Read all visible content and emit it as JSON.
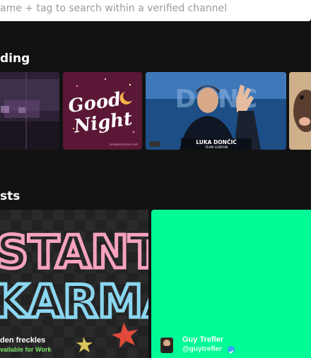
{
  "search": {
    "placeholder": "ame + tag to search within a verified channel"
  },
  "sections": {
    "trending_title": "ding",
    "artists_title": "sts"
  },
  "trending": {
    "cards": [
      {
        "id": "card-1"
      },
      {
        "id": "card-2",
        "text_line1": "Good",
        "text_line2": "Night",
        "watermark": "sendwishonline.com"
      },
      {
        "id": "card-3",
        "player_name": "LUKA DONČIĆ",
        "team": "TEAM LEBRON",
        "backdrop_text": "DONC"
      },
      {
        "id": "card-4"
      }
    ]
  },
  "artists": [
    {
      "name": "den freckles",
      "subtitle": "vailable for Work",
      "subtitle_color": "#7ee36b",
      "art_text_1": "STANT",
      "art_text_2": "KARMA"
    },
    {
      "name": "Guy Trefler",
      "handle": "@guytrefler",
      "bg_color": "#00fa96",
      "verified_color": "#3aa0ff"
    }
  ]
}
